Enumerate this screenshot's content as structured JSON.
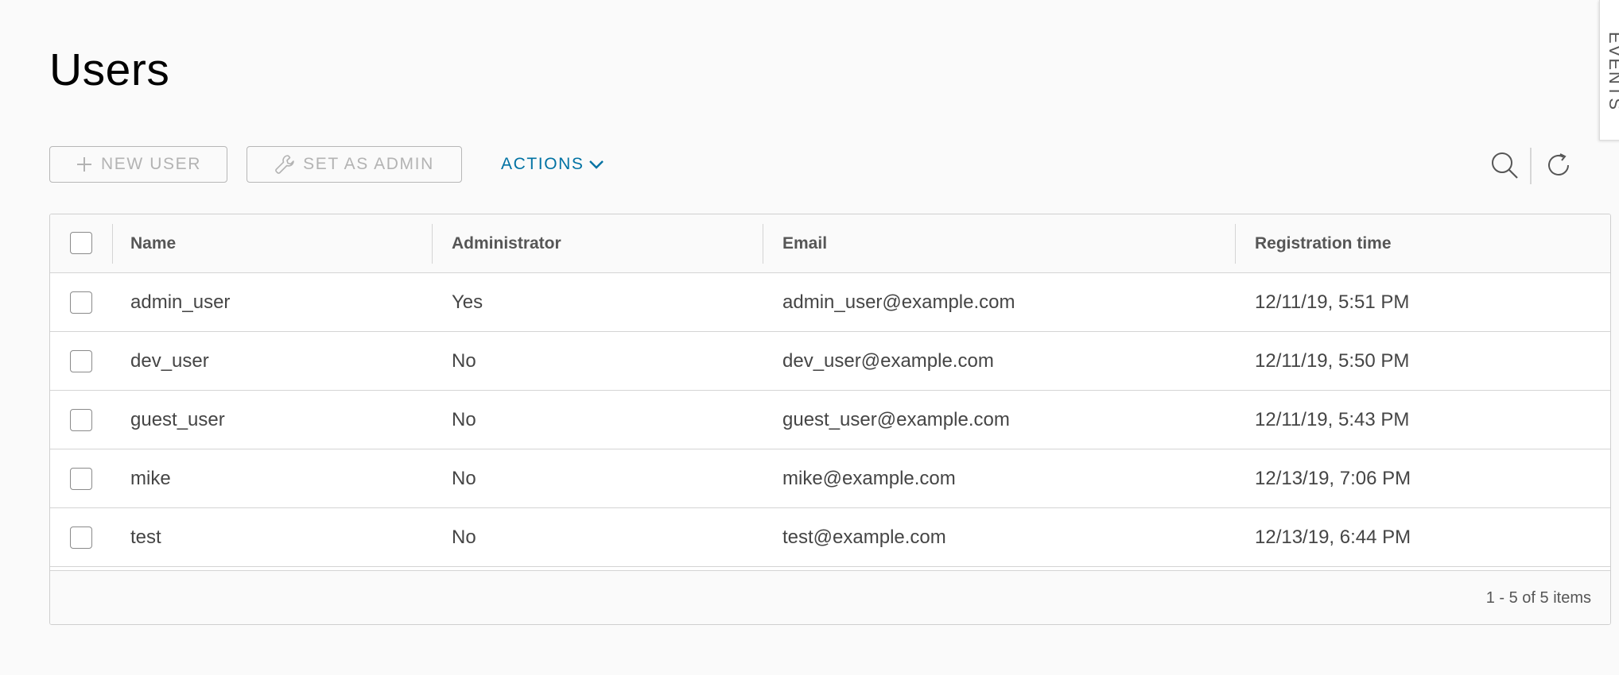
{
  "page": {
    "title": "Users"
  },
  "side_tab": {
    "label": "EVENTS"
  },
  "toolbar": {
    "new_user_label": "NEW USER",
    "set_as_admin_label": "SET AS ADMIN",
    "actions_label": "ACTIONS",
    "icons": [
      "plus-icon",
      "wrench-icon",
      "chevron-down-icon",
      "search-icon",
      "refresh-icon"
    ],
    "disabled_color": "#b3b3b3",
    "accent_color": "#0072a3"
  },
  "table": {
    "columns": [
      "Name",
      "Administrator",
      "Email",
      "Registration time"
    ],
    "rows": [
      {
        "name": "admin_user",
        "admin": "Yes",
        "email": "admin_user@example.com",
        "registered": "12/11/19, 5:51 PM"
      },
      {
        "name": "dev_user",
        "admin": "No",
        "email": "dev_user@example.com",
        "registered": "12/11/19, 5:50 PM"
      },
      {
        "name": "guest_user",
        "admin": "No",
        "email": "guest_user@example.com",
        "registered": "12/11/19, 5:43 PM"
      },
      {
        "name": "mike",
        "admin": "No",
        "email": "mike@example.com",
        "registered": "12/13/19, 7:06 PM"
      },
      {
        "name": "test",
        "admin": "No",
        "email": "test@example.com",
        "registered": "12/13/19, 6:44 PM"
      }
    ],
    "footer": "1 - 5 of 5 items"
  }
}
